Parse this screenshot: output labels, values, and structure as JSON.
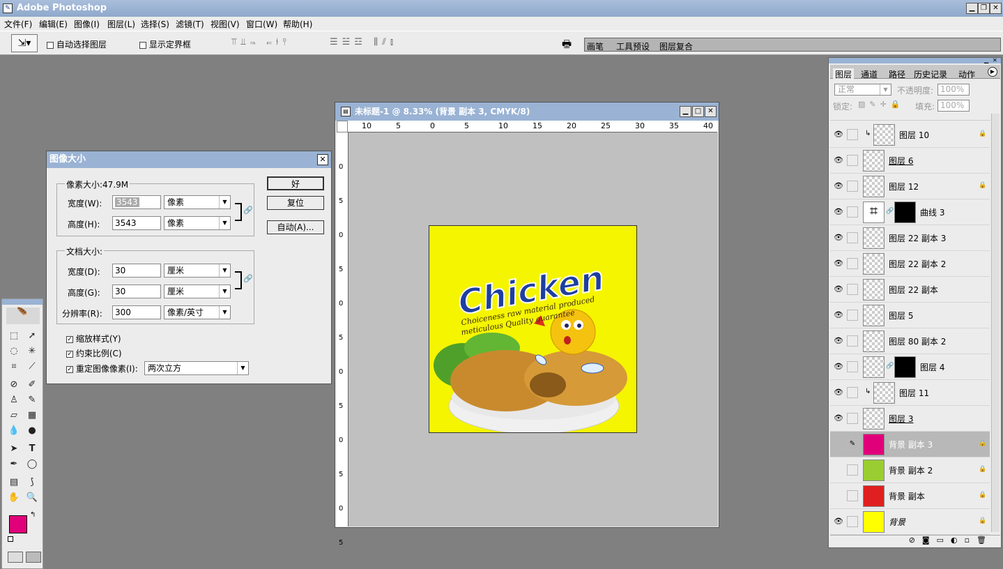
{
  "app": {
    "title": "Adobe Photoshop",
    "icon": "photoshop-icon"
  },
  "menu": [
    "文件(F)",
    "编辑(E)",
    "图像(I)",
    "图层(L)",
    "选择(S)",
    "滤镜(T)",
    "视图(V)",
    "窗口(W)",
    "帮助(H)"
  ],
  "options": {
    "auto_select": "自动选择图层",
    "show_bounds": "显示定界框",
    "tabs": [
      "画笔",
      "工具预设",
      "图层复合"
    ]
  },
  "dialog": {
    "title": "图像大小",
    "pixel_size": "像素大小:47.9M",
    "width_label": "宽度(W):",
    "width_value": "3543",
    "width_unit": "像素",
    "height_label": "高度(H):",
    "height_value": "3543",
    "height_unit": "像素",
    "doc_size": "文档大小:",
    "doc_width_label": "宽度(D):",
    "doc_width_value": "30",
    "doc_width_unit": "厘米",
    "doc_height_label": "高度(G):",
    "doc_height_value": "30",
    "doc_height_unit": "厘米",
    "res_label": "分辨率(R):",
    "res_value": "300",
    "res_unit": "像素/英寸",
    "scale_styles": "缩放样式(Y)",
    "constrain": "约束比例(C)",
    "resample": "重定图像像素(I):",
    "resample_value": "两次立方",
    "ok": "好",
    "reset": "复位",
    "auto": "自动(A)..."
  },
  "document": {
    "title": "未标题-1 @ 8.33% (背景 副本 3, CMYK/8)",
    "ruler_h": [
      "10",
      "5",
      "0",
      "5",
      "10",
      "15",
      "20",
      "25",
      "30",
      "35",
      "40"
    ],
    "ruler_v": [
      "0",
      "5",
      "0",
      "5",
      "0",
      "5",
      "0",
      "5",
      "0",
      "5",
      "0",
      "5",
      "0"
    ],
    "art": {
      "headline": "Chicken",
      "tagline1": "Choiceness raw material produced",
      "tagline2": "meticulous Quality guarantee"
    }
  },
  "layers_panel": {
    "tabs": [
      "图层",
      "通道",
      "路径",
      "历史记录",
      "动作"
    ],
    "blend": "正常",
    "opacity_label": "不透明度:",
    "opacity": "100%",
    "lock_label": "锁定:",
    "fill_label": "填充:",
    "fill": "100%",
    "layers": [
      {
        "name": "图层 10",
        "visible": true,
        "thumb": "checker",
        "locked": true,
        "clip": true
      },
      {
        "name": "图层 6",
        "visible": true,
        "thumb": "checker",
        "locked": false,
        "underline": true
      },
      {
        "name": "图层 12",
        "visible": true,
        "thumb": "checker",
        "locked": true
      },
      {
        "name": "曲线 3",
        "visible": true,
        "thumb": "curves",
        "locked": false,
        "mask": true
      },
      {
        "name": "图层 22 副本 3",
        "visible": true,
        "thumb": "checker",
        "locked": false
      },
      {
        "name": "图层 22 副本 2",
        "visible": true,
        "thumb": "checker",
        "locked": false
      },
      {
        "name": "图层 22 副本",
        "visible": true,
        "thumb": "checker",
        "locked": false
      },
      {
        "name": "图层 5",
        "visible": true,
        "thumb": "checker",
        "locked": false
      },
      {
        "name": "图层 80 副本 2",
        "visible": true,
        "thumb": "checker",
        "locked": false
      },
      {
        "name": "图层 4",
        "visible": true,
        "thumb": "checker",
        "locked": false,
        "mask": true
      },
      {
        "name": "图层 11",
        "visible": true,
        "thumb": "checker",
        "locked": false,
        "clip": true
      },
      {
        "name": "图层 3",
        "visible": true,
        "thumb": "checker",
        "locked": false,
        "underline": true
      },
      {
        "name": "背景 副本 3",
        "visible": false,
        "thumb": "#e0007a",
        "locked": true,
        "selected": true
      },
      {
        "name": "背景 副本 2",
        "visible": false,
        "thumb": "#9acd32",
        "locked": true
      },
      {
        "name": "背景 副本",
        "visible": false,
        "thumb": "#e02020",
        "locked": true
      },
      {
        "name": "背景",
        "visible": true,
        "thumb": "#ffff00",
        "locked": true,
        "italic": true
      }
    ]
  },
  "colors": {
    "foreground": "#e0007a",
    "background": "#222222",
    "canvas_bg": "#f5f500"
  }
}
